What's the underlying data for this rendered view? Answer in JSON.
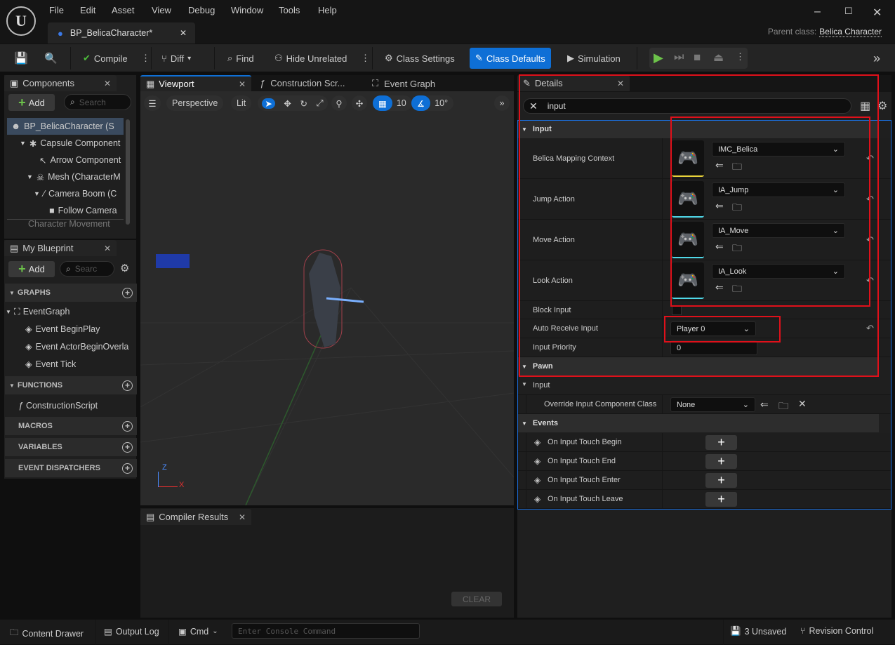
{
  "menu": [
    "File",
    "Edit",
    "Asset",
    "View",
    "Debug",
    "Window",
    "Tools",
    "Help"
  ],
  "document_tab": {
    "title": "BP_BelicaCharacter*"
  },
  "parent_class": {
    "label": "Parent class:",
    "value": "Belica Character"
  },
  "toolbar": {
    "compile": "Compile",
    "diff": "Diff",
    "find": "Find",
    "hide_unrelated": "Hide Unrelated",
    "class_settings": "Class Settings",
    "class_defaults": "Class Defaults",
    "simulation": "Simulation"
  },
  "components": {
    "tab": "Components",
    "add": "Add",
    "search_placeholder": "Search",
    "items": [
      "BP_BelicaCharacter (S",
      "Capsule Component",
      "Arrow Component",
      "Mesh (CharacterM",
      "Camera Boom (C",
      "Follow Camera",
      "Character Movement"
    ]
  },
  "my_blueprint": {
    "tab": "My Blueprint",
    "add": "Add",
    "search_placeholder": "Searc",
    "graphs": "GRAPHS",
    "event_graph": "EventGraph",
    "events": [
      "Event BeginPlay",
      "Event ActorBeginOverla",
      "Event Tick"
    ],
    "functions": "FUNCTIONS",
    "construction": "ConstructionScript",
    "macros": "MACROS",
    "variables": "VARIABLES",
    "dispatchers": "EVENT DISPATCHERS"
  },
  "editor_tabs": {
    "viewport": "Viewport",
    "construction": "Construction Scr...",
    "event_graph": "Event Graph"
  },
  "viewport_toolbar": {
    "perspective": "Perspective",
    "lit": "Lit",
    "grid_snap": "10",
    "rot_snap": "10°"
  },
  "axis": {
    "z": "Z",
    "x": "X"
  },
  "compiler": {
    "tab": "Compiler Results",
    "clear": "CLEAR"
  },
  "details": {
    "tab": "Details",
    "search_value": "input",
    "input_section": "Input",
    "asset_rows": [
      {
        "label": "Belica Mapping Context",
        "value": "IMC_Belica",
        "accent": "#e8d23a"
      },
      {
        "label": "Jump Action",
        "value": "IA_Jump",
        "accent": "#4fd8e8"
      },
      {
        "label": "Move Action",
        "value": "IA_Move",
        "accent": "#4fd8e8"
      },
      {
        "label": "Look Action",
        "value": "IA_Look",
        "accent": "#4fd8e8"
      }
    ],
    "block_input": {
      "label": "Block Input",
      "checked": false
    },
    "auto_receive": {
      "label": "Auto Receive Input",
      "value": "Player 0"
    },
    "input_priority": {
      "label": "Input Priority",
      "value": "0"
    },
    "pawn_section": "Pawn",
    "pawn_input": "Input",
    "override": {
      "label": "Override Input Component Class",
      "value": "None"
    },
    "events_section": "Events",
    "events": [
      "On Input Touch Begin",
      "On Input Touch End",
      "On Input Touch Enter",
      "On Input Touch Leave"
    ]
  },
  "status": {
    "content_drawer": "Content Drawer",
    "output_log": "Output Log",
    "cmd": "Cmd",
    "console_placeholder": "Enter Console Command",
    "unsaved": "3 Unsaved",
    "revision": "Revision Control"
  },
  "colors": {
    "accent": "#0e6fd6",
    "annotation_red": "#e0101a",
    "annotation_blue": "#1a6fe0"
  }
}
